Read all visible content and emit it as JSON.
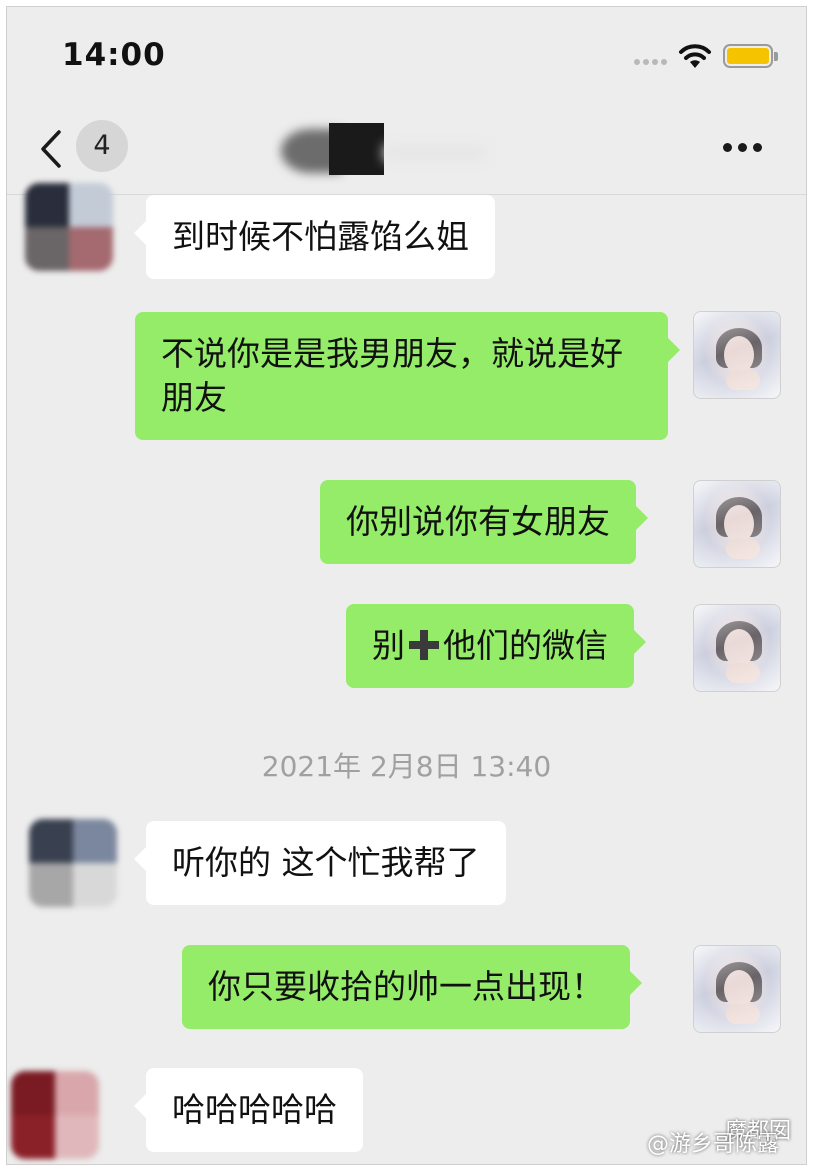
{
  "status_bar": {
    "time": "14:00",
    "battery_color": "#f5c300"
  },
  "nav": {
    "unread_count": "4",
    "more_icon": "more-horizontal-icon",
    "back_icon": "chevron-left-icon"
  },
  "colors": {
    "outgoing_bubble": "#95ec69",
    "incoming_bubble": "#ffffff",
    "background": "#ededed"
  },
  "messages": [
    {
      "side": "in",
      "text": "到时候不怕露馅么姐"
    },
    {
      "side": "out",
      "text": "不说你是是我男朋友，就说是好朋友"
    },
    {
      "side": "out",
      "text": "你别说你有女朋友"
    },
    {
      "side": "out",
      "text_before": "别",
      "emoji": "plus-icon",
      "text_after": "他们的微信"
    },
    {
      "side": "in",
      "text": "听你的 这个忙我帮了"
    },
    {
      "side": "out",
      "text": "你只要收拾的帅一点出现！"
    },
    {
      "side": "in",
      "text": "哈哈哈哈哈"
    }
  ],
  "timestamp": "2021年 2月8日 13:40",
  "watermark": {
    "brand": "魔都囡",
    "handle": "@游乡哥陈露"
  }
}
